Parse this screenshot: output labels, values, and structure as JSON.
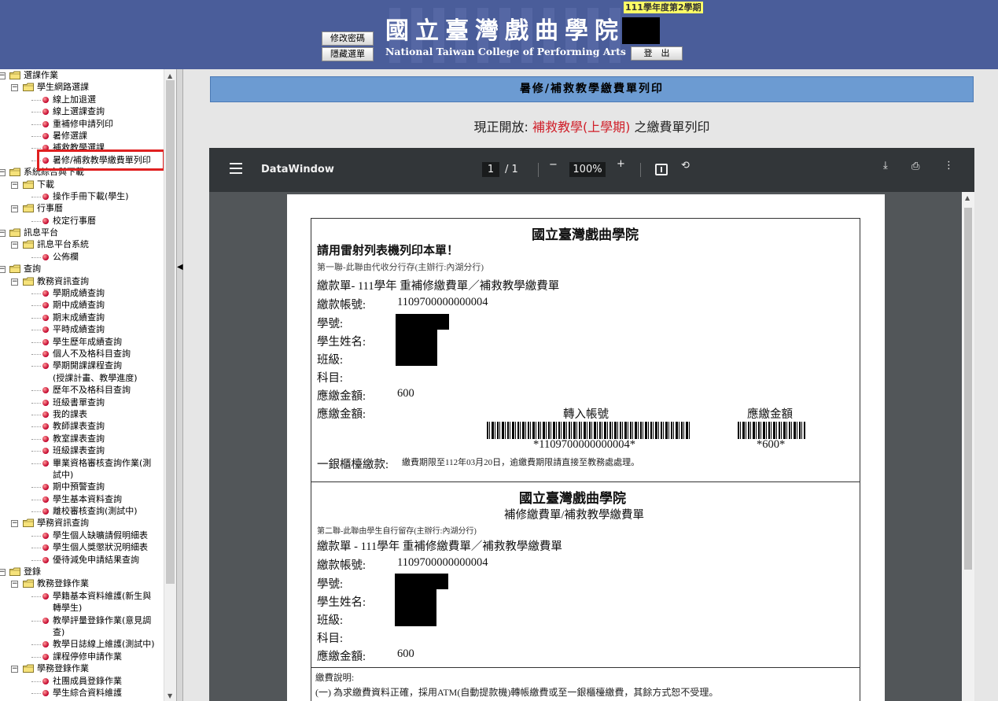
{
  "header": {
    "btn_change_password": "修改密碼",
    "btn_hide_menu": "隱藏選單",
    "btn_logout": "登　出",
    "school_cn": "國立臺灣戲曲學院",
    "school_en": "National Taiwan College of Performing Arts",
    "term": "111學年度第2學期"
  },
  "tree": {
    "items": [
      {
        "level": 0,
        "type": "folder",
        "label": "選課作業"
      },
      {
        "level": 1,
        "type": "folder",
        "label": "學生網路選課"
      },
      {
        "level": 2,
        "type": "leaf",
        "label": "線上加退選"
      },
      {
        "level": 2,
        "type": "leaf",
        "label": "線上選課查詢"
      },
      {
        "level": 2,
        "type": "leaf",
        "label": "重補修申請列印"
      },
      {
        "level": 2,
        "type": "leaf",
        "label": "暑修選課"
      },
      {
        "level": 2,
        "type": "leaf",
        "label": "補救教學選課"
      },
      {
        "level": 2,
        "type": "leaf",
        "label": "暑修/補救教學繳費單列印"
      },
      {
        "level": 0,
        "type": "folder",
        "label": "系統綜合與下載"
      },
      {
        "level": 1,
        "type": "folder",
        "label": "下載"
      },
      {
        "level": 2,
        "type": "leaf",
        "label": "操作手冊下載(學生)"
      },
      {
        "level": 1,
        "type": "folder",
        "label": "行事曆"
      },
      {
        "level": 2,
        "type": "leaf",
        "label": "校定行事曆"
      },
      {
        "level": 0,
        "type": "folder",
        "label": "訊息平台"
      },
      {
        "level": 1,
        "type": "folder",
        "label": "訊息平台系統"
      },
      {
        "level": 2,
        "type": "leaf",
        "label": "公佈欄"
      },
      {
        "level": 0,
        "type": "folder",
        "label": "查詢"
      },
      {
        "level": 1,
        "type": "folder",
        "label": "教務資訊查詢"
      },
      {
        "level": 2,
        "type": "leaf",
        "label": "學期成績查詢"
      },
      {
        "level": 2,
        "type": "leaf",
        "label": "期中成績查詢"
      },
      {
        "level": 2,
        "type": "leaf",
        "label": "期末成績查詢"
      },
      {
        "level": 2,
        "type": "leaf",
        "label": "平時成績查詢"
      },
      {
        "level": 2,
        "type": "leaf",
        "label": "學生歷年成績查詢"
      },
      {
        "level": 2,
        "type": "leaf",
        "label": "個人不及格科目查詢"
      },
      {
        "level": 2,
        "type": "leaf",
        "label": "學期開課課程查詢"
      },
      {
        "level": 2,
        "type": "cont",
        "label": "(授課計畫、教學進度)"
      },
      {
        "level": 2,
        "type": "leaf",
        "label": "歷年不及格科目查詢"
      },
      {
        "level": 2,
        "type": "leaf",
        "label": "班級書單查詢"
      },
      {
        "level": 2,
        "type": "leaf",
        "label": "我的課表"
      },
      {
        "level": 2,
        "type": "leaf",
        "label": "教師課表查詢"
      },
      {
        "level": 2,
        "type": "leaf",
        "label": "教室課表查詢"
      },
      {
        "level": 2,
        "type": "leaf",
        "label": "班級課表查詢"
      },
      {
        "level": 2,
        "type": "leaf",
        "label": "畢業資格審核查詢作業(測"
      },
      {
        "level": 2,
        "type": "cont",
        "label": "試中)"
      },
      {
        "level": 2,
        "type": "leaf",
        "label": "期中預警查詢"
      },
      {
        "level": 2,
        "type": "leaf",
        "label": "學生基本資料查詢"
      },
      {
        "level": 2,
        "type": "leaf",
        "label": "離校審核查詢(測試中)"
      },
      {
        "level": 1,
        "type": "folder",
        "label": "學務資訊查詢"
      },
      {
        "level": 2,
        "type": "leaf",
        "label": "學生個人缺曠請假明細表"
      },
      {
        "level": 2,
        "type": "leaf",
        "label": "學生個人獎懲狀況明細表"
      },
      {
        "level": 2,
        "type": "leaf",
        "label": "優待減免申請結果查詢"
      },
      {
        "level": 0,
        "type": "folder",
        "label": "登錄"
      },
      {
        "level": 1,
        "type": "folder",
        "label": "教務登錄作業"
      },
      {
        "level": 2,
        "type": "leaf",
        "label": "學籍基本資料維護(新生與"
      },
      {
        "level": 2,
        "type": "cont",
        "label": "轉學生)"
      },
      {
        "level": 2,
        "type": "leaf",
        "label": "教學評量登錄作業(意見調"
      },
      {
        "level": 2,
        "type": "cont",
        "label": "查)"
      },
      {
        "level": 2,
        "type": "leaf",
        "label": "教學日誌線上維護(測試中)"
      },
      {
        "level": 2,
        "type": "leaf",
        "label": "課程停修申請作業"
      },
      {
        "level": 1,
        "type": "folder",
        "label": "學務登錄作業"
      },
      {
        "level": 2,
        "type": "leaf",
        "label": "社團成員登錄作業"
      },
      {
        "level": 2,
        "type": "leaf",
        "label": "學生綜合資料維護"
      },
      {
        "level": 2,
        "type": "leaf",
        "label": ""
      }
    ]
  },
  "main": {
    "page_title": "暑修/補救教學繳費單列印",
    "open_prefix": "現正開放: ",
    "open_highlight": "補救教學(上學期)",
    "open_suffix": " 之繳費單列印"
  },
  "pdf": {
    "doc_name": "DataWindow",
    "page_current": "1",
    "page_total": "/  1",
    "zoom": "100%"
  },
  "receipt": {
    "slip1": {
      "school": "國立臺灣戲曲學院",
      "notice": "請用雷射列表機列印本單！",
      "copy_note": "第一聯-此聯由代收分行存(主辦行:內湖分行)",
      "bill_line": "繳款單-  111學年   重補修繳費單／補救教學繳費單",
      "account_label": "繳款帳號:",
      "account": "1109700000000004",
      "student_no": "學號:",
      "student_name": "學生姓名:",
      "class": "班級:",
      "subject": "科目:",
      "amount_label": "應繳金額:",
      "amount": "600",
      "amount_label2": "應繳金額:",
      "transfer_label": "轉入帳號",
      "amount_col_label": "應繳金額",
      "barcode_account_text": "*1109700000000004*",
      "barcode_amount_text": "*600*",
      "counter_label": "一銀櫃檯繳款:",
      "counter_note": "繳費期限至112年03月20日，逾繳費期限請直接至教務處處理。"
    },
    "slip2": {
      "school": "國立臺灣戲曲學院",
      "subtitle": "補修繳費單/補救教學繳費單",
      "copy_note": "第二聯-此聯由學生自行留存(主辦行:內湖分行)",
      "bill_line": "繳款單 - 111學年   重補修繳費單／補救教學繳費單",
      "account_label": "繳款帳號:",
      "account": "1109700000000004",
      "student_no": "學號:",
      "student_name": "學生姓名:",
      "class": "班級:",
      "subject": "科目:",
      "amount_label": "應繳金額:",
      "amount": "600"
    },
    "slip3": {
      "title": "繳費說明:",
      "line1": "(一) 為求繳費資料正確，採用ATM(自動提款機)轉帳繳費或至一銀櫃檯繳費，其餘方式恕不受理。"
    }
  }
}
